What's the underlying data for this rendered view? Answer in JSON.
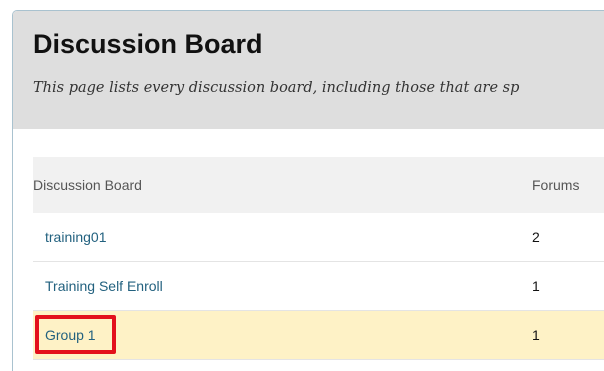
{
  "header": {
    "title": "Discussion Board",
    "subtitle": "This page lists every discussion board, including those that are sp"
  },
  "table": {
    "columns": {
      "name": "Discussion Board",
      "forums": "Forums"
    },
    "rows": [
      {
        "name": "training01",
        "forums": "2"
      },
      {
        "name": "Training Self Enroll",
        "forums": "1"
      },
      {
        "name": "Group 1",
        "forums": "1"
      }
    ]
  },
  "colors": {
    "link": "#22617f",
    "highlight_row": "#fef2c6",
    "callout_box": "#e3101c",
    "header_background": "#dedede"
  }
}
